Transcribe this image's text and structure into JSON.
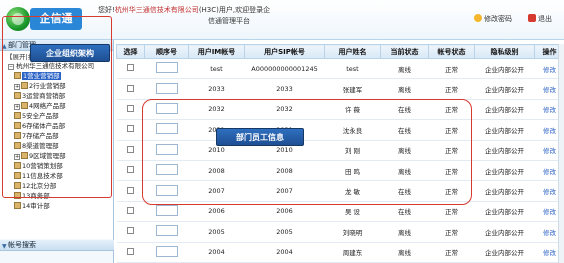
{
  "header": {
    "logo_text": "企信通",
    "welcome_prefix": "您好!",
    "company": "杭州华三通信技术有限公司",
    "welcome_suffix": "(H3C)用户,欢迎登录企",
    "platform": "信通管理平台",
    "change_password": "修改密码",
    "exit": "退出"
  },
  "sidebar": {
    "dept_panel_title": "部门管理",
    "account_panel_title": "帐号搜索",
    "tag": "【展开|折叠】",
    "root": "杭州华三通信技术有限公司",
    "nodes": [
      {
        "label": "1营业营销部",
        "selected": true
      },
      {
        "label": "2行业营销部"
      },
      {
        "label": "3运营商营销部"
      },
      {
        "label": "4网络产品部"
      },
      {
        "label": "5安全产品部"
      },
      {
        "label": "6存储体产品部"
      },
      {
        "label": "7存储产品部"
      },
      {
        "label": "8渠道管理部"
      },
      {
        "label": "9区域管理部"
      },
      {
        "label": "10营销策划部"
      },
      {
        "label": "11信息技术部"
      },
      {
        "label": "12北京分部"
      },
      {
        "label": "13商务部"
      },
      {
        "label": "14审计部"
      }
    ]
  },
  "annotations": {
    "left": "企业组织架构",
    "grid": "部门员工信息"
  },
  "table": {
    "columns": [
      "选择",
      "顺序号",
      "用户IM帐号",
      "用户SIP帐号",
      "用户姓名",
      "当前状态",
      "帐号状态",
      "隐私级别",
      "操作"
    ],
    "rows": [
      {
        "im": "test",
        "sip": "A000000000001245",
        "name": "test",
        "cur": "离线",
        "acct": "正常",
        "privacy": "企业内部公开",
        "op": "修改"
      },
      {
        "im": "2033",
        "sip": "2033",
        "name": "张建军",
        "cur": "离线",
        "acct": "正常",
        "privacy": "企业内部公开",
        "op": "修改"
      },
      {
        "im": "2032",
        "sip": "2032",
        "name": "许 薇",
        "cur": "在线",
        "acct": "正常",
        "privacy": "企业内部公开",
        "op": "修改"
      },
      {
        "im": "2031",
        "sip": "2031",
        "name": "沈永良",
        "cur": "在线",
        "acct": "正常",
        "privacy": "企业内部公开",
        "op": "修改"
      },
      {
        "im": "2010",
        "sip": "2010",
        "name": "刘 刚",
        "cur": "离线",
        "acct": "正常",
        "privacy": "企业内部公开",
        "op": "修改"
      },
      {
        "im": "2008",
        "sip": "2008",
        "name": "田 鸣",
        "cur": "离线",
        "acct": "正常",
        "privacy": "企业内部公开",
        "op": "修改"
      },
      {
        "im": "2007",
        "sip": "2007",
        "name": "龙 敏",
        "cur": "在线",
        "acct": "正常",
        "privacy": "企业内部公开",
        "op": "修改"
      },
      {
        "im": "2006",
        "sip": "2006",
        "name": "吴 设",
        "cur": "在线",
        "acct": "正常",
        "privacy": "企业内部公开",
        "op": "修改"
      },
      {
        "im": "2005",
        "sip": "2005",
        "name": "刘晓明",
        "cur": "离线",
        "acct": "正常",
        "privacy": "企业内部公开",
        "op": "修改"
      },
      {
        "im": "2004",
        "sip": "2004",
        "name": "周建东",
        "cur": "离线",
        "acct": "正常",
        "privacy": "企业内部公开",
        "op": "修改"
      }
    ]
  },
  "colors": {
    "accent_blue": "#2a86d6",
    "annotation_red": "#d63a2f",
    "header_border": "#b9d3e8"
  }
}
